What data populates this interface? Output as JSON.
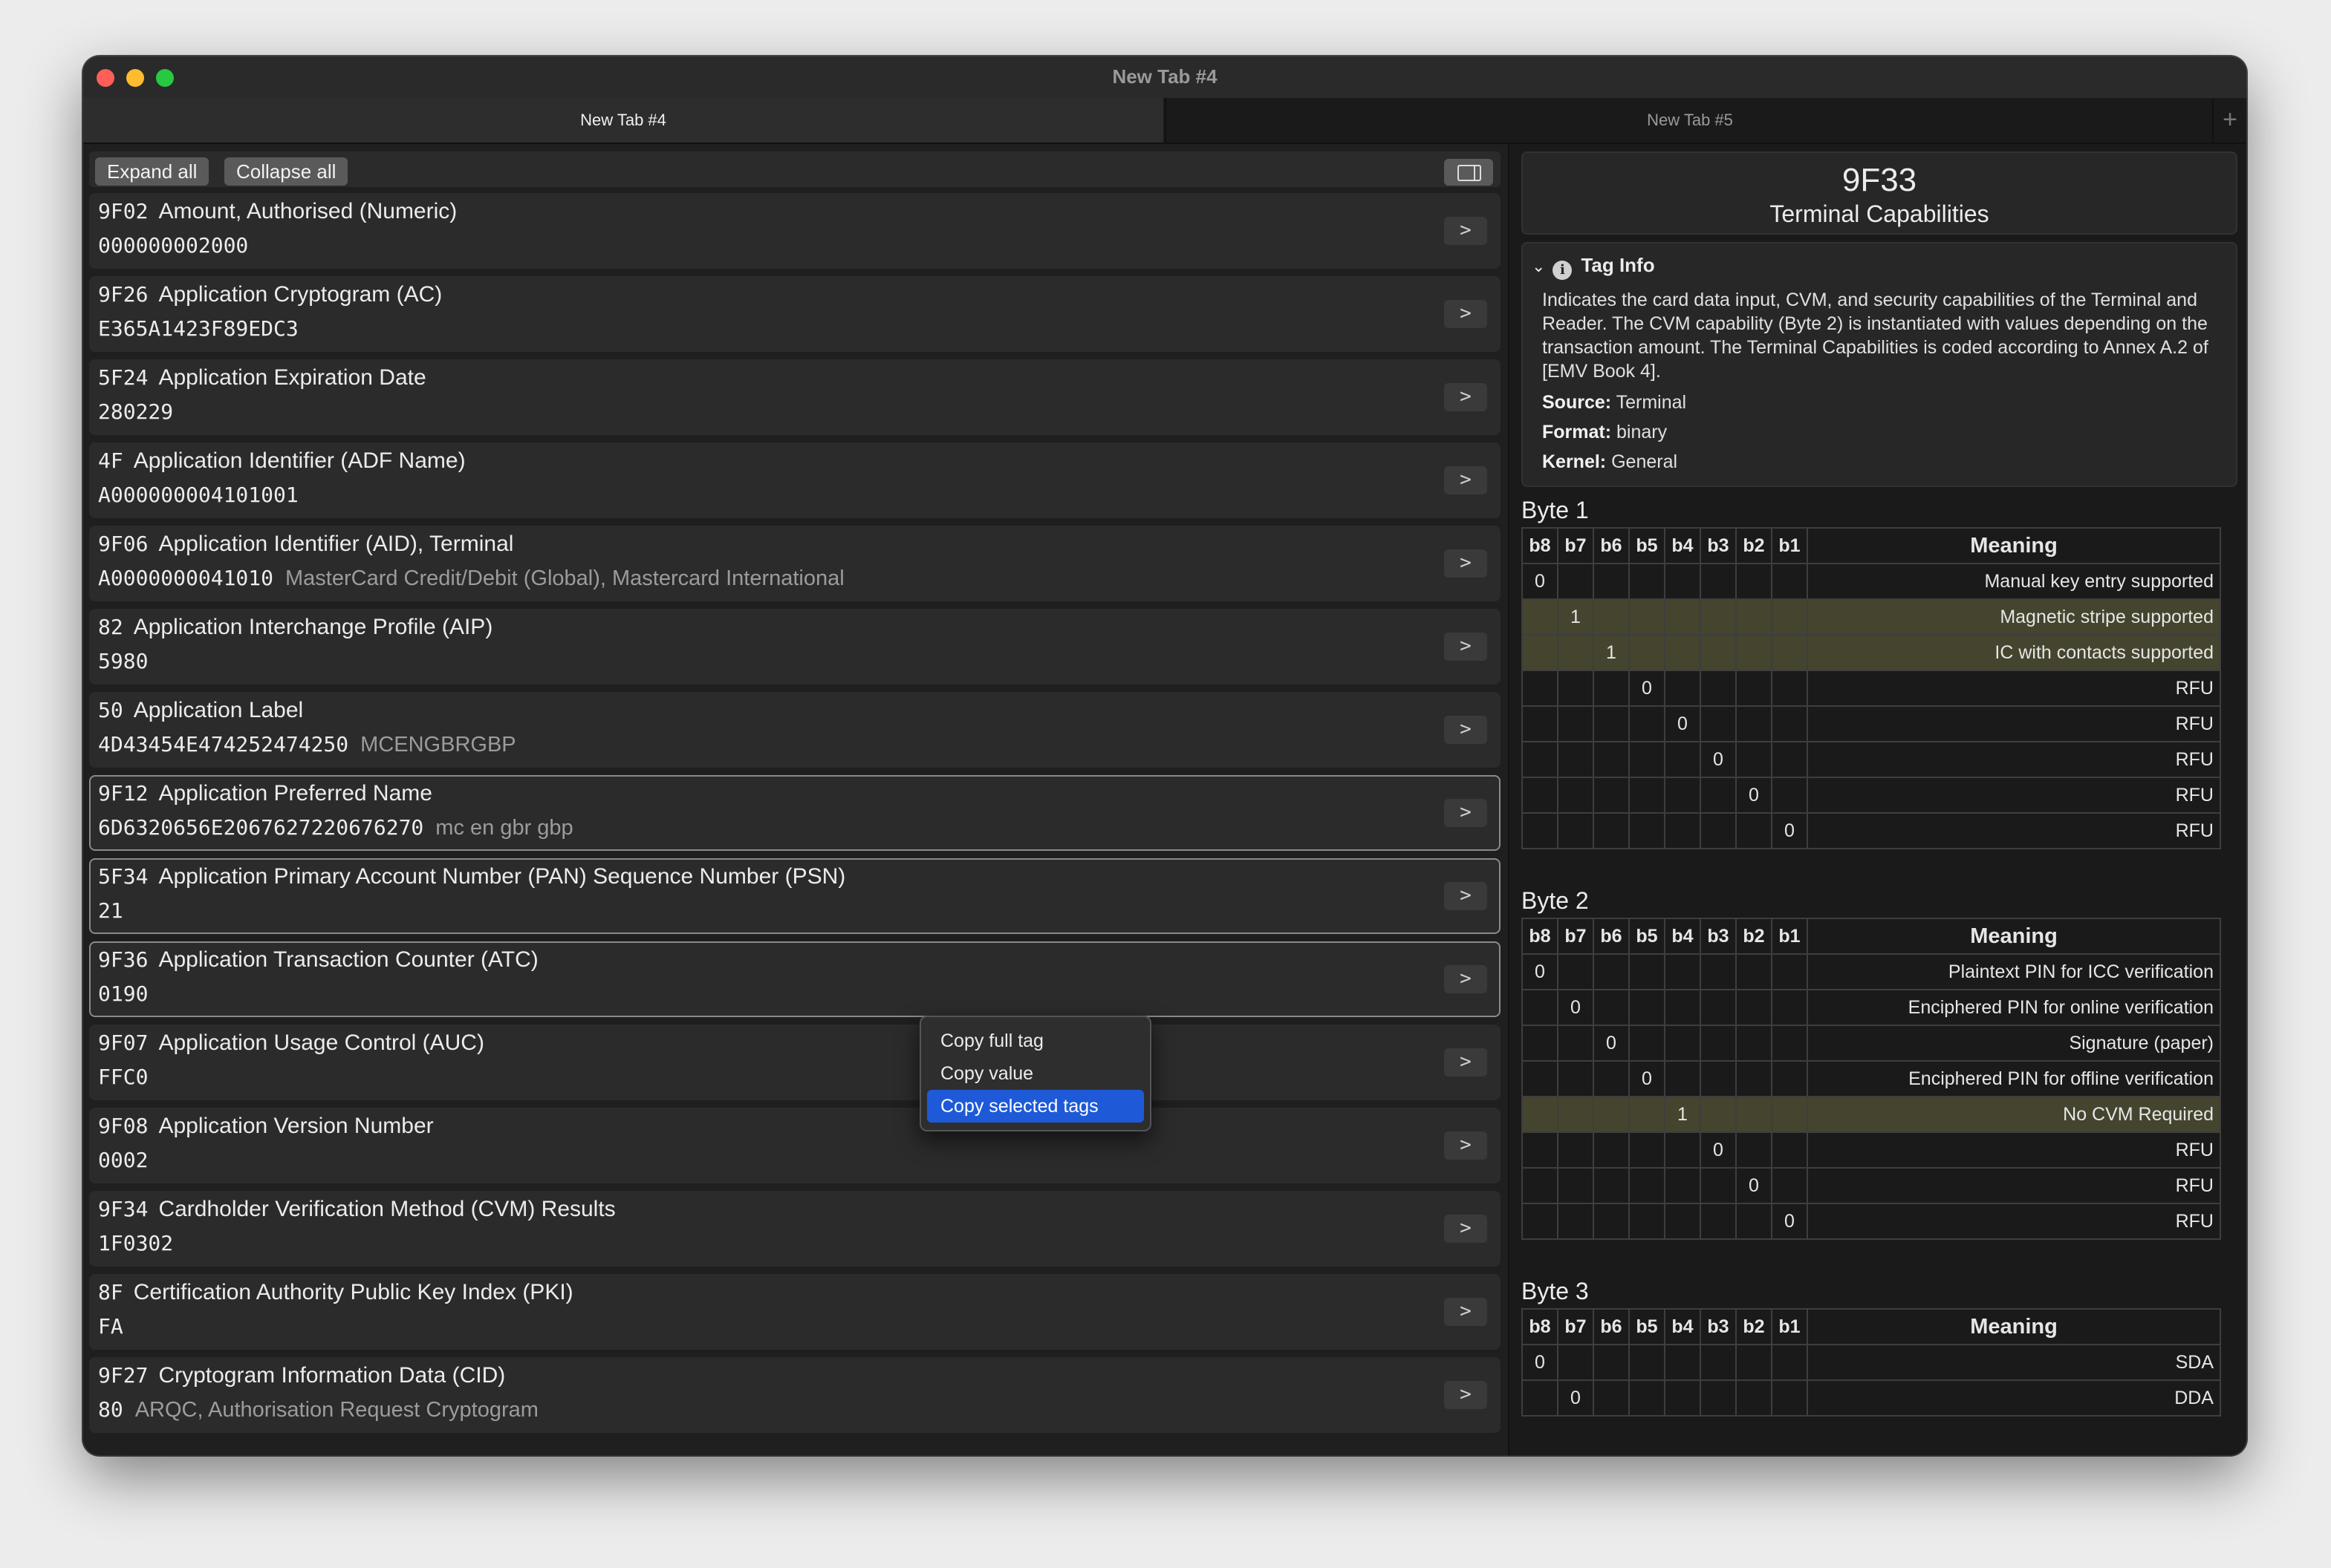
{
  "window": {
    "title": "New Tab #4"
  },
  "tabs": [
    {
      "label": "New Tab #4"
    },
    {
      "label": "New Tab #5"
    },
    {
      "label": "+"
    }
  ],
  "toolbar": {
    "expand_all": "Expand all",
    "collapse_all": "Collapse all"
  },
  "tags": [
    {
      "id": "9F02",
      "name": "Amount, Authorised (Numeric)",
      "value": "000000002000",
      "desc": ""
    },
    {
      "id": "9F26",
      "name": "Application Cryptogram (AC)",
      "value": "E365A1423F89EDC3",
      "desc": ""
    },
    {
      "id": "5F24",
      "name": "Application Expiration Date",
      "value": "280229",
      "desc": ""
    },
    {
      "id": "4F",
      "name": "Application Identifier (ADF Name)",
      "value": "A000000004101001",
      "desc": ""
    },
    {
      "id": "9F06",
      "name": "Application Identifier (AID), Terminal",
      "value": "A0000000041010",
      "desc": "MasterCard Credit/Debit (Global), Mastercard International"
    },
    {
      "id": "82",
      "name": "Application Interchange Profile (AIP)",
      "value": "5980",
      "desc": ""
    },
    {
      "id": "50",
      "name": "Application Label",
      "value": "4D43454E474252474250",
      "desc": "MCENGBRGBP"
    },
    {
      "id": "9F12",
      "name": "Application Preferred Name",
      "value": "6D6320656E2067627220676270",
      "desc": "mc en gbr gbp"
    },
    {
      "id": "5F34",
      "name": "Application Primary Account Number (PAN) Sequence Number (PSN)",
      "value": "21",
      "desc": ""
    },
    {
      "id": "9F36",
      "name": "Application Transaction Counter (ATC)",
      "value": "0190",
      "desc": ""
    },
    {
      "id": "9F07",
      "name": "Application Usage Control (AUC)",
      "value": "FFC0",
      "desc": ""
    },
    {
      "id": "9F08",
      "name": "Application Version Number",
      "value": "0002",
      "desc": ""
    },
    {
      "id": "9F34",
      "name": "Cardholder Verification Method (CVM) Results",
      "value": "1F0302",
      "desc": ""
    },
    {
      "id": "8F",
      "name": "Certification Authority Public Key Index (PKI)",
      "value": "FA",
      "desc": ""
    },
    {
      "id": "9F27",
      "name": "Cryptogram Information Data (CID)",
      "value": "80",
      "desc": "ARQC, Authorisation Request Cryptogram"
    }
  ],
  "row_button": ">",
  "context_menu": {
    "items": [
      "Copy full tag",
      "Copy value",
      "Copy selected tags"
    ],
    "highlighted": 2
  },
  "detail": {
    "tag": "9F33",
    "name": "Terminal Capabilities",
    "info": {
      "heading": "Tag Info",
      "description": "Indicates the card data input, CVM, and security capabilities of the Terminal and Reader. The CVM capability (Byte 2) is instantiated with values depending on the transaction amount. The Terminal Capabilities is coded according to Annex A.2 of [EMV Book 4].",
      "source_label": "Source:",
      "source": "Terminal",
      "format_label": "Format:",
      "format": "binary",
      "kernel_label": "Kernel:",
      "kernel": "General"
    },
    "bit_headers": [
      "b8",
      "b7",
      "b6",
      "b5",
      "b4",
      "b3",
      "b2",
      "b1",
      "Meaning"
    ],
    "bytes": [
      {
        "title": "Byte 1",
        "rows": [
          {
            "pos": 0,
            "val": "0",
            "meaning": "Manual key entry supported",
            "hl": false
          },
          {
            "pos": 1,
            "val": "1",
            "meaning": "Magnetic stripe supported",
            "hl": true
          },
          {
            "pos": 2,
            "val": "1",
            "meaning": "IC with contacts supported",
            "hl": true
          },
          {
            "pos": 3,
            "val": "0",
            "meaning": "RFU",
            "hl": false
          },
          {
            "pos": 4,
            "val": "0",
            "meaning": "RFU",
            "hl": false
          },
          {
            "pos": 5,
            "val": "0",
            "meaning": "RFU",
            "hl": false
          },
          {
            "pos": 6,
            "val": "0",
            "meaning": "RFU",
            "hl": false
          },
          {
            "pos": 7,
            "val": "0",
            "meaning": "RFU",
            "hl": false
          }
        ]
      },
      {
        "title": "Byte 2",
        "rows": [
          {
            "pos": 0,
            "val": "0",
            "meaning": "Plaintext PIN for ICC verification",
            "hl": false
          },
          {
            "pos": 1,
            "val": "0",
            "meaning": "Enciphered PIN for online verification",
            "hl": false
          },
          {
            "pos": 2,
            "val": "0",
            "meaning": "Signature (paper)",
            "hl": false
          },
          {
            "pos": 3,
            "val": "0",
            "meaning": "Enciphered PIN for offline verification",
            "hl": false
          },
          {
            "pos": 4,
            "val": "1",
            "meaning": "No CVM Required",
            "hl": true
          },
          {
            "pos": 5,
            "val": "0",
            "meaning": "RFU",
            "hl": false
          },
          {
            "pos": 6,
            "val": "0",
            "meaning": "RFU",
            "hl": false
          },
          {
            "pos": 7,
            "val": "0",
            "meaning": "RFU",
            "hl": false
          }
        ]
      },
      {
        "title": "Byte 3",
        "rows": [
          {
            "pos": 0,
            "val": "0",
            "meaning": "SDA",
            "hl": false
          },
          {
            "pos": 1,
            "val": "0",
            "meaning": "DDA",
            "hl": false
          }
        ]
      }
    ]
  },
  "colors": {
    "highlight_row": "#45442e",
    "menu_highlight": "#1e5ad8",
    "selected_border": "#8a8a8a"
  }
}
